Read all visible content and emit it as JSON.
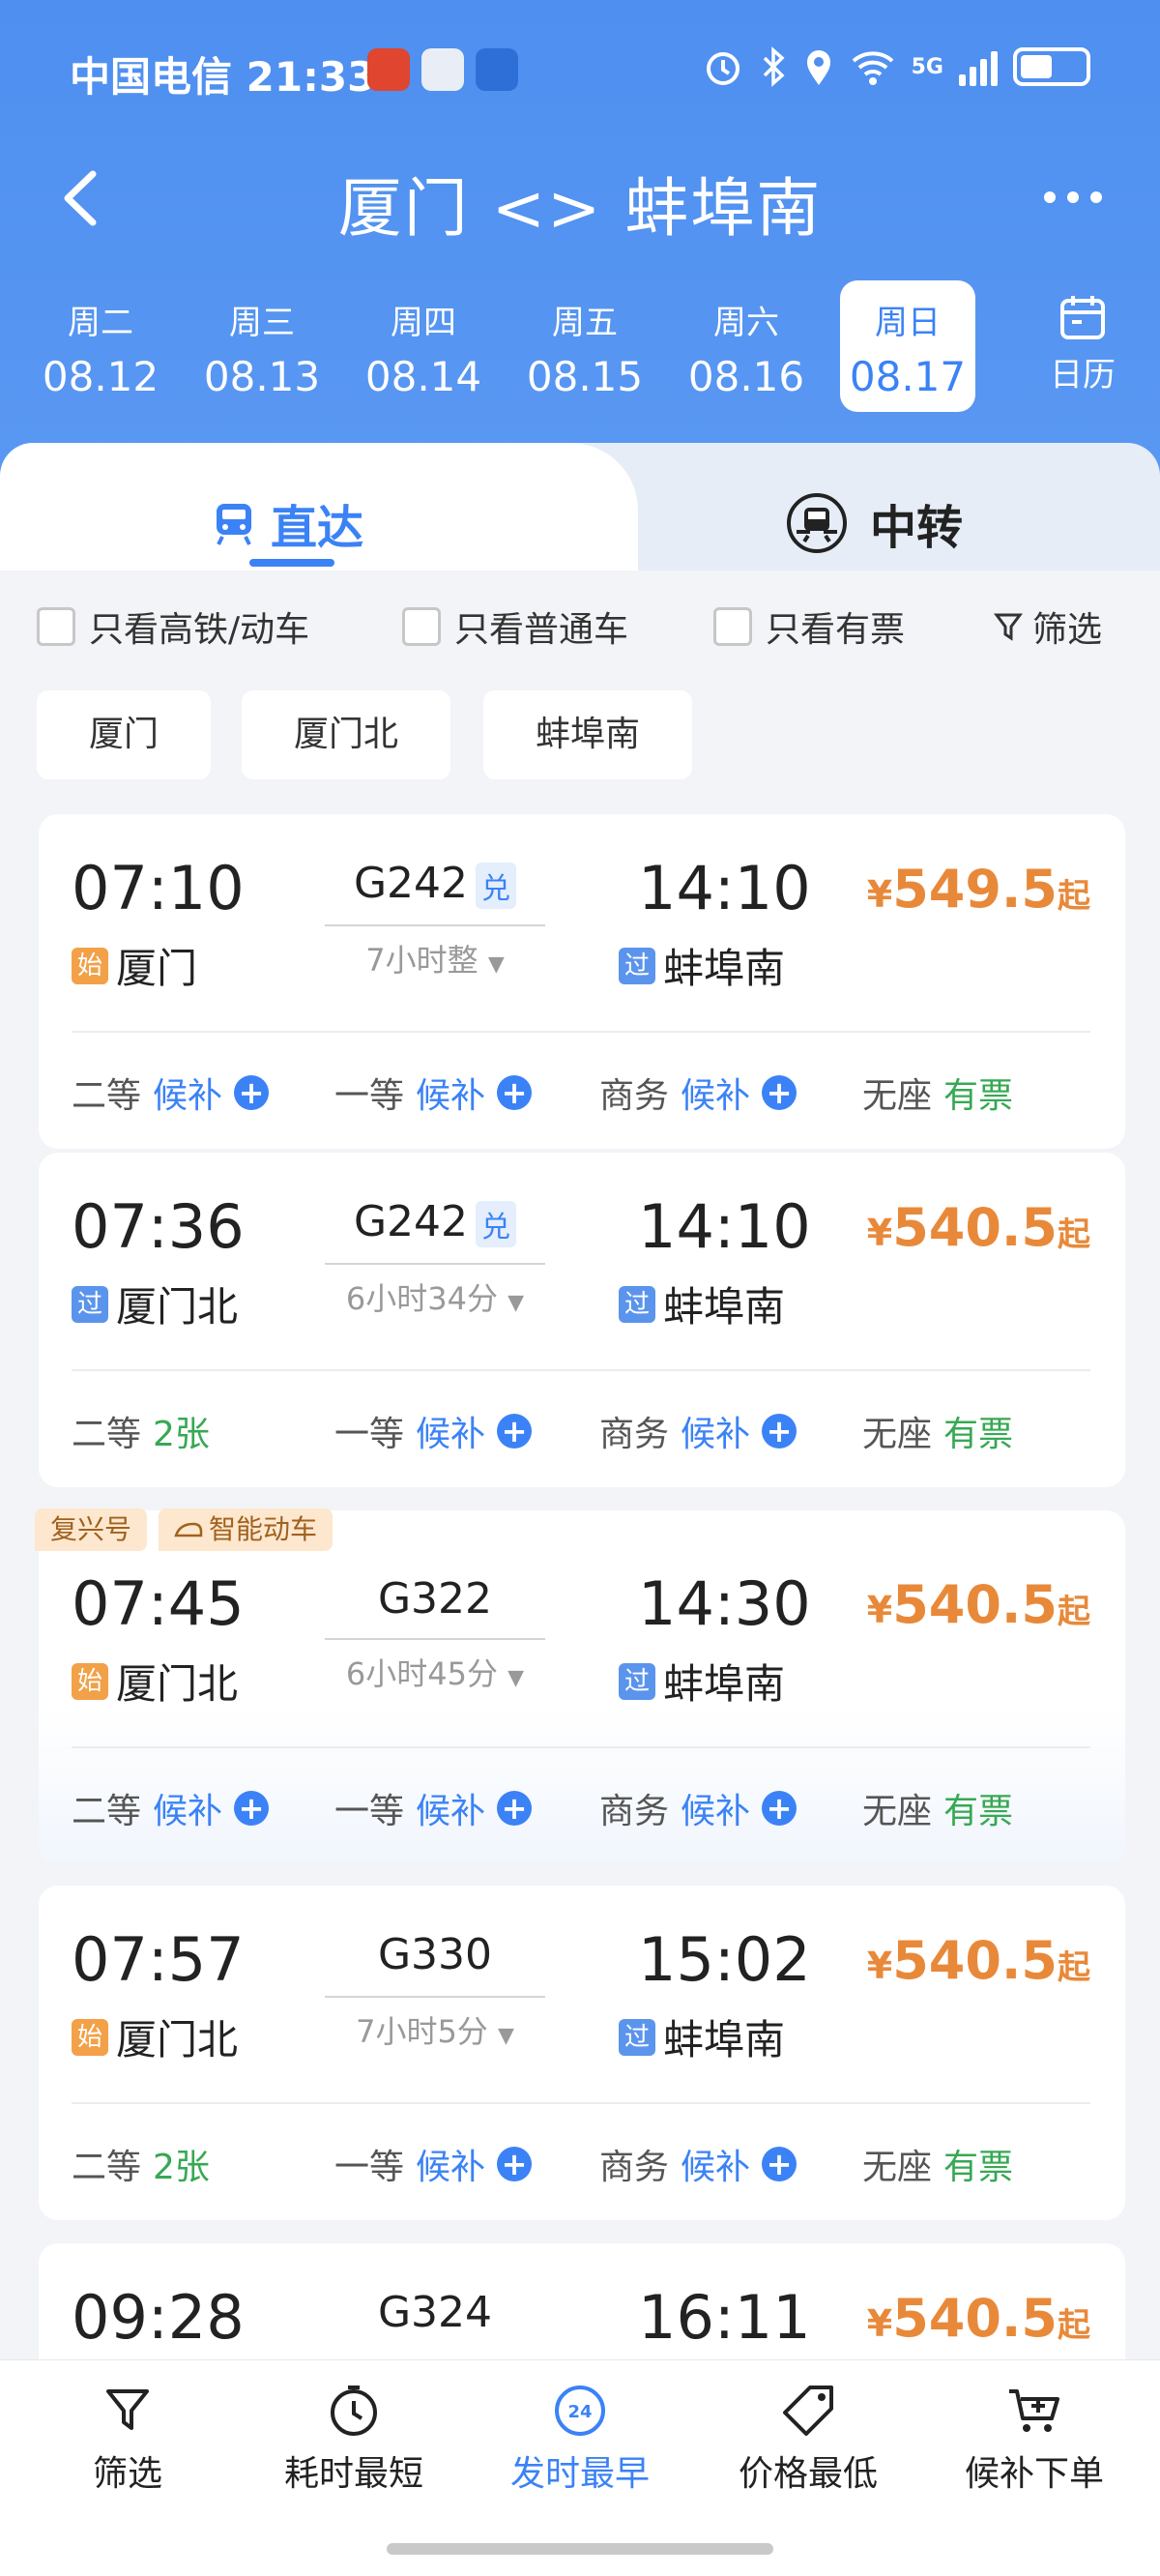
{
  "status_bar": {
    "carrier": "中国电信",
    "time": "21:33",
    "network": "5G"
  },
  "nav": {
    "title": "厦门 <> 蚌埠南"
  },
  "dates": [
    {
      "week": "周二",
      "date": "08.12"
    },
    {
      "week": "周三",
      "date": "08.13"
    },
    {
      "week": "周四",
      "date": "08.14"
    },
    {
      "week": "周五",
      "date": "08.15"
    },
    {
      "week": "周六",
      "date": "08.16"
    },
    {
      "week": "周日",
      "date": "08.17",
      "selected": true
    }
  ],
  "calendar_label": "日历",
  "tabs": {
    "direct": "直达",
    "transfer": "中转"
  },
  "filters": {
    "high_speed": "只看高铁/动车",
    "normal": "只看普通车",
    "available": "只看有票",
    "filter": "筛选"
  },
  "stations": [
    "厦门",
    "厦门北",
    "蚌埠南"
  ],
  "trains": [
    {
      "dep": "07:10",
      "train": "G242",
      "dui": "兑",
      "arr": "14:10",
      "duration": "7小时整",
      "price": "549.5",
      "price_suffix": "起",
      "currency": "¥",
      "from_tag": "始",
      "from": "厦门",
      "to_tag": "过",
      "to": "蚌埠南",
      "seats": [
        {
          "class": "二等",
          "status": "候补"
        },
        {
          "class": "一等",
          "status": "候补"
        },
        {
          "class": "商务",
          "status": "候补"
        },
        {
          "class": "无座",
          "status": "有票"
        }
      ]
    },
    {
      "dep": "07:36",
      "train": "G242",
      "dui": "兑",
      "arr": "14:10",
      "duration": "6小时34分",
      "price": "540.5",
      "price_suffix": "起",
      "currency": "¥",
      "from_tag": "过",
      "from": "厦门北",
      "to_tag": "过",
      "to": "蚌埠南",
      "seats": [
        {
          "class": "二等",
          "status": "2张"
        },
        {
          "class": "一等",
          "status": "候补"
        },
        {
          "class": "商务",
          "status": "候补"
        },
        {
          "class": "无座",
          "status": "有票"
        }
      ]
    },
    {
      "badges": [
        "复兴号",
        "智能动车"
      ],
      "dep": "07:45",
      "train": "G322",
      "arr": "14:30",
      "duration": "6小时45分",
      "price": "540.5",
      "price_suffix": "起",
      "currency": "¥",
      "from_tag": "始",
      "from": "厦门北",
      "to_tag": "过",
      "to": "蚌埠南",
      "seats": [
        {
          "class": "二等",
          "status": "候补"
        },
        {
          "class": "一等",
          "status": "候补"
        },
        {
          "class": "商务",
          "status": "候补"
        },
        {
          "class": "无座",
          "status": "有票"
        }
      ]
    },
    {
      "dep": "07:57",
      "train": "G330",
      "arr": "15:02",
      "duration": "7小时5分",
      "price": "540.5",
      "price_suffix": "起",
      "currency": "¥",
      "from_tag": "始",
      "from": "厦门北",
      "to_tag": "过",
      "to": "蚌埠南",
      "seats": [
        {
          "class": "二等",
          "status": "2张"
        },
        {
          "class": "一等",
          "status": "候补"
        },
        {
          "class": "商务",
          "status": "候补"
        },
        {
          "class": "无座",
          "status": "有票"
        }
      ]
    },
    {
      "dep": "09:28",
      "train": "G324",
      "arr": "16:11",
      "price": "540.5",
      "price_suffix": "起",
      "currency": "¥"
    }
  ],
  "bottom_bar": {
    "filter": "筛选",
    "shortest": "耗时最短",
    "earliest": "发时最早",
    "earliest_icon_text": "24",
    "cheapest": "价格最低",
    "waitlist": "候补下单"
  },
  "colors": {
    "primary": "#3b82f6",
    "header": "#4e8ff0",
    "price": "#e8893a",
    "available": "#37a853"
  }
}
